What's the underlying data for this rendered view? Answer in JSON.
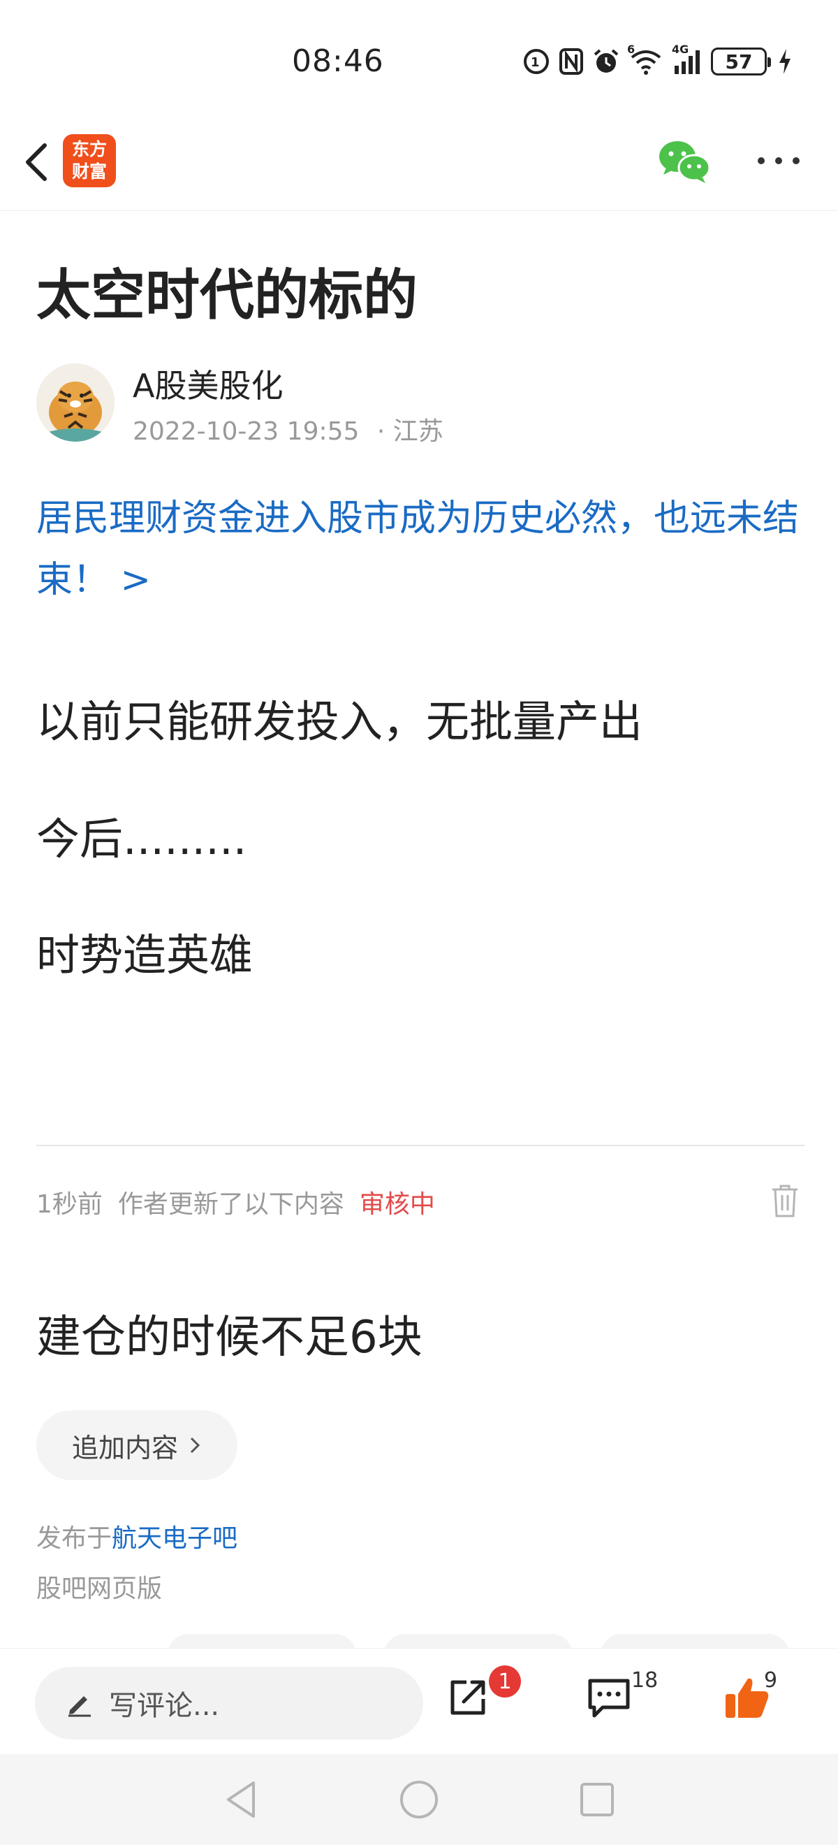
{
  "status_bar": {
    "time": "08:46",
    "battery": "57",
    "network": "4G",
    "wifi_badge": "6"
  },
  "nav": {
    "logo_line1": "东方",
    "logo_line2": "财富"
  },
  "article": {
    "title": "太空时代的标的",
    "author": "A股美股化",
    "timestamp": "2022-10-23 19:55",
    "location": "· 江苏",
    "promo": "居民理财资金进入股市成为历史必然，也远未结束！ >",
    "paragraphs": [
      "以前只能研发投入，无批量产出",
      "今后.........",
      "时势造英雄"
    ]
  },
  "update": {
    "time_ago": "1秒前",
    "note": "作者更新了以下内容",
    "status": "审核中",
    "content": "建仓的时候不足6块",
    "append_label": "追加内容"
  },
  "footer": {
    "published_prefix": "发布于",
    "bar_name": "航天电子吧",
    "web_version": "股吧网页版"
  },
  "action_bar": {
    "comment_placeholder": "写评论...",
    "share_badge": "1",
    "comments_count": "18",
    "likes_count": "9"
  },
  "colors": {
    "brand": "#f04f1b",
    "link": "#1a6bc4",
    "review": "#e34a4a",
    "like": "#f06414",
    "wechat": "#4cc24a"
  }
}
